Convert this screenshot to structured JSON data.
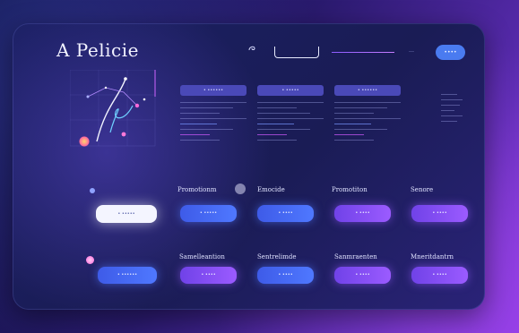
{
  "app": {
    "logo": "A Pelicie"
  },
  "header": {
    "nav_icon": "swirl-icon",
    "search_placeholder": "",
    "link_text": "…",
    "signup_label": "••••"
  },
  "columns": [
    {
      "tag": "• ••••••"
    },
    {
      "tag": "• •••••"
    },
    {
      "tag": "• ••••••"
    }
  ],
  "sections_row1": {
    "labels": [
      "Promotionm",
      "Emocide",
      "Promotiton",
      "Senore"
    ],
    "buttons": [
      "• •••••",
      "• ••••",
      "• ••••",
      "• ••••"
    ],
    "white_button": "• •••••"
  },
  "sections_row2": {
    "labels": [
      "Samelleantion",
      "Sentrelimde",
      "Sanmraenten",
      "Mneritdantrn"
    ],
    "buttons": [
      "• ••••",
      "• ••••",
      "• ••••",
      "• ••••"
    ],
    "left_button": "• ••••••"
  },
  "colors": {
    "accent_blue": "#4f78ff",
    "accent_violet": "#9b5bff",
    "panel": "#1b2063"
  }
}
